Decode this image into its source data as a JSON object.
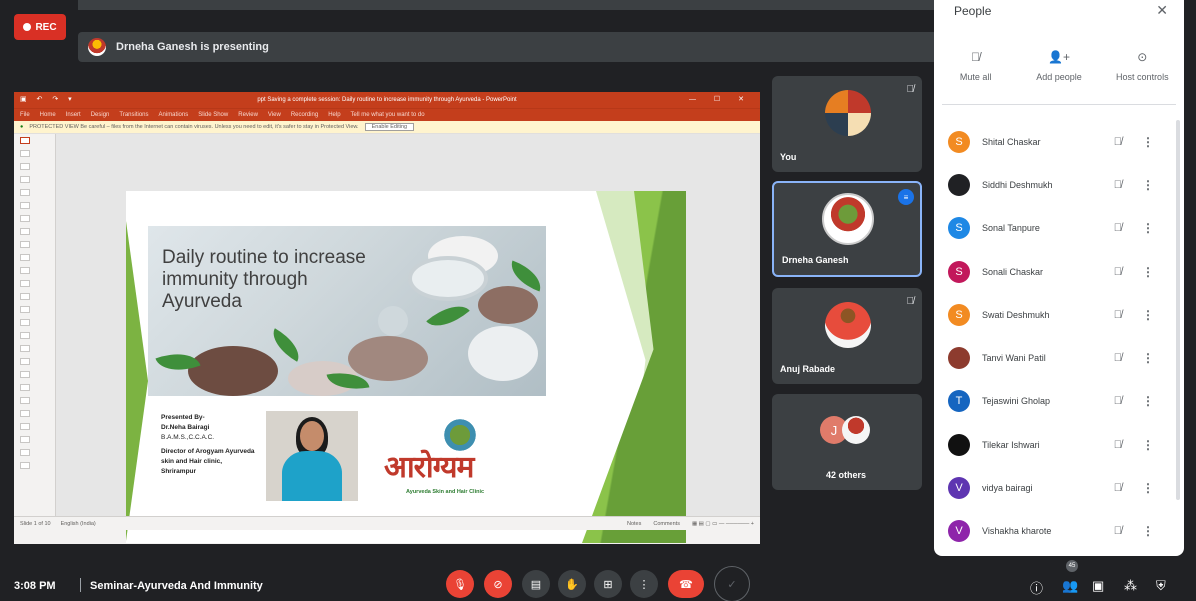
{
  "recording": {
    "label": "REC"
  },
  "presenting": {
    "text": "Drneha Ganesh is presenting"
  },
  "powerpoint": {
    "title_bar": "ppt Saving a complete session: Daily routine to increase immunity through Ayurveda - PowerPoint",
    "menu": [
      "File",
      "Home",
      "Insert",
      "Design",
      "Transitions",
      "Animations",
      "Slide Show",
      "Review",
      "View",
      "Recording",
      "Help",
      "Tell me what you want to do"
    ],
    "protected_view": "PROTECTED VIEW  Be careful – files from the Internet can contain viruses. Unless you need to edit, it's safer to stay in Protected View.",
    "enable_editing": "Enable Editing",
    "status_left": "Slide 1 of 10",
    "status_lang": "English (India)",
    "status_notes": "Notes",
    "status_comments": "Comments"
  },
  "slide": {
    "heading": "Daily routine to increase immunity through Ayurveda",
    "presented_by": "Presented By-",
    "presenter_name": "Dr.Neha Bairagi",
    "degree": "B.A.M.S.,C.C.A.C.",
    "director": "Director of Arogyam Ayurveda skin and Hair clinic, Shrirampur",
    "logo_text": "आरोग्यम",
    "logo_sub": "Ayurveda Skin and Hair Clinic"
  },
  "tiles": [
    {
      "name": "You"
    },
    {
      "name": "Drneha Ganesh"
    },
    {
      "name": "Anuj Rabade"
    },
    {
      "name": "42 others",
      "initial": "J"
    }
  ],
  "people_panel": {
    "title": "People",
    "actions": [
      {
        "label": "Mute all",
        "icon": "mic-off-icon"
      },
      {
        "label": "Add people",
        "icon": "add-person-icon"
      },
      {
        "label": "Host controls",
        "icon": "host-controls-icon"
      }
    ],
    "participants": [
      {
        "name": "Shital Chaskar",
        "initial": "S",
        "color": "#f28b22"
      },
      {
        "name": "Siddhi Deshmukh",
        "initial": "",
        "color": "#202124"
      },
      {
        "name": "Sonal Tanpure",
        "initial": "S",
        "color": "#1e88e5"
      },
      {
        "name": "Sonali Chaskar",
        "initial": "S",
        "color": "#c2185b"
      },
      {
        "name": "Swati Deshmukh",
        "initial": "S",
        "color": "#f28b22"
      },
      {
        "name": "Tanvi Wani Patil",
        "initial": "",
        "color": "#8d3b2e"
      },
      {
        "name": "Tejaswini Gholap",
        "initial": "T",
        "color": "#1565c0"
      },
      {
        "name": "Tilekar Ishwari",
        "initial": "",
        "color": "#111111"
      },
      {
        "name": "vidya bairagi",
        "initial": "V",
        "color": "#5e35b1"
      },
      {
        "name": "Vishakha kharote",
        "initial": "V",
        "color": "#8e24aa"
      }
    ]
  },
  "bottom_bar": {
    "time": "3:08 PM",
    "meeting": "Seminar-Ayurveda And Immunity",
    "people_count": "45"
  }
}
